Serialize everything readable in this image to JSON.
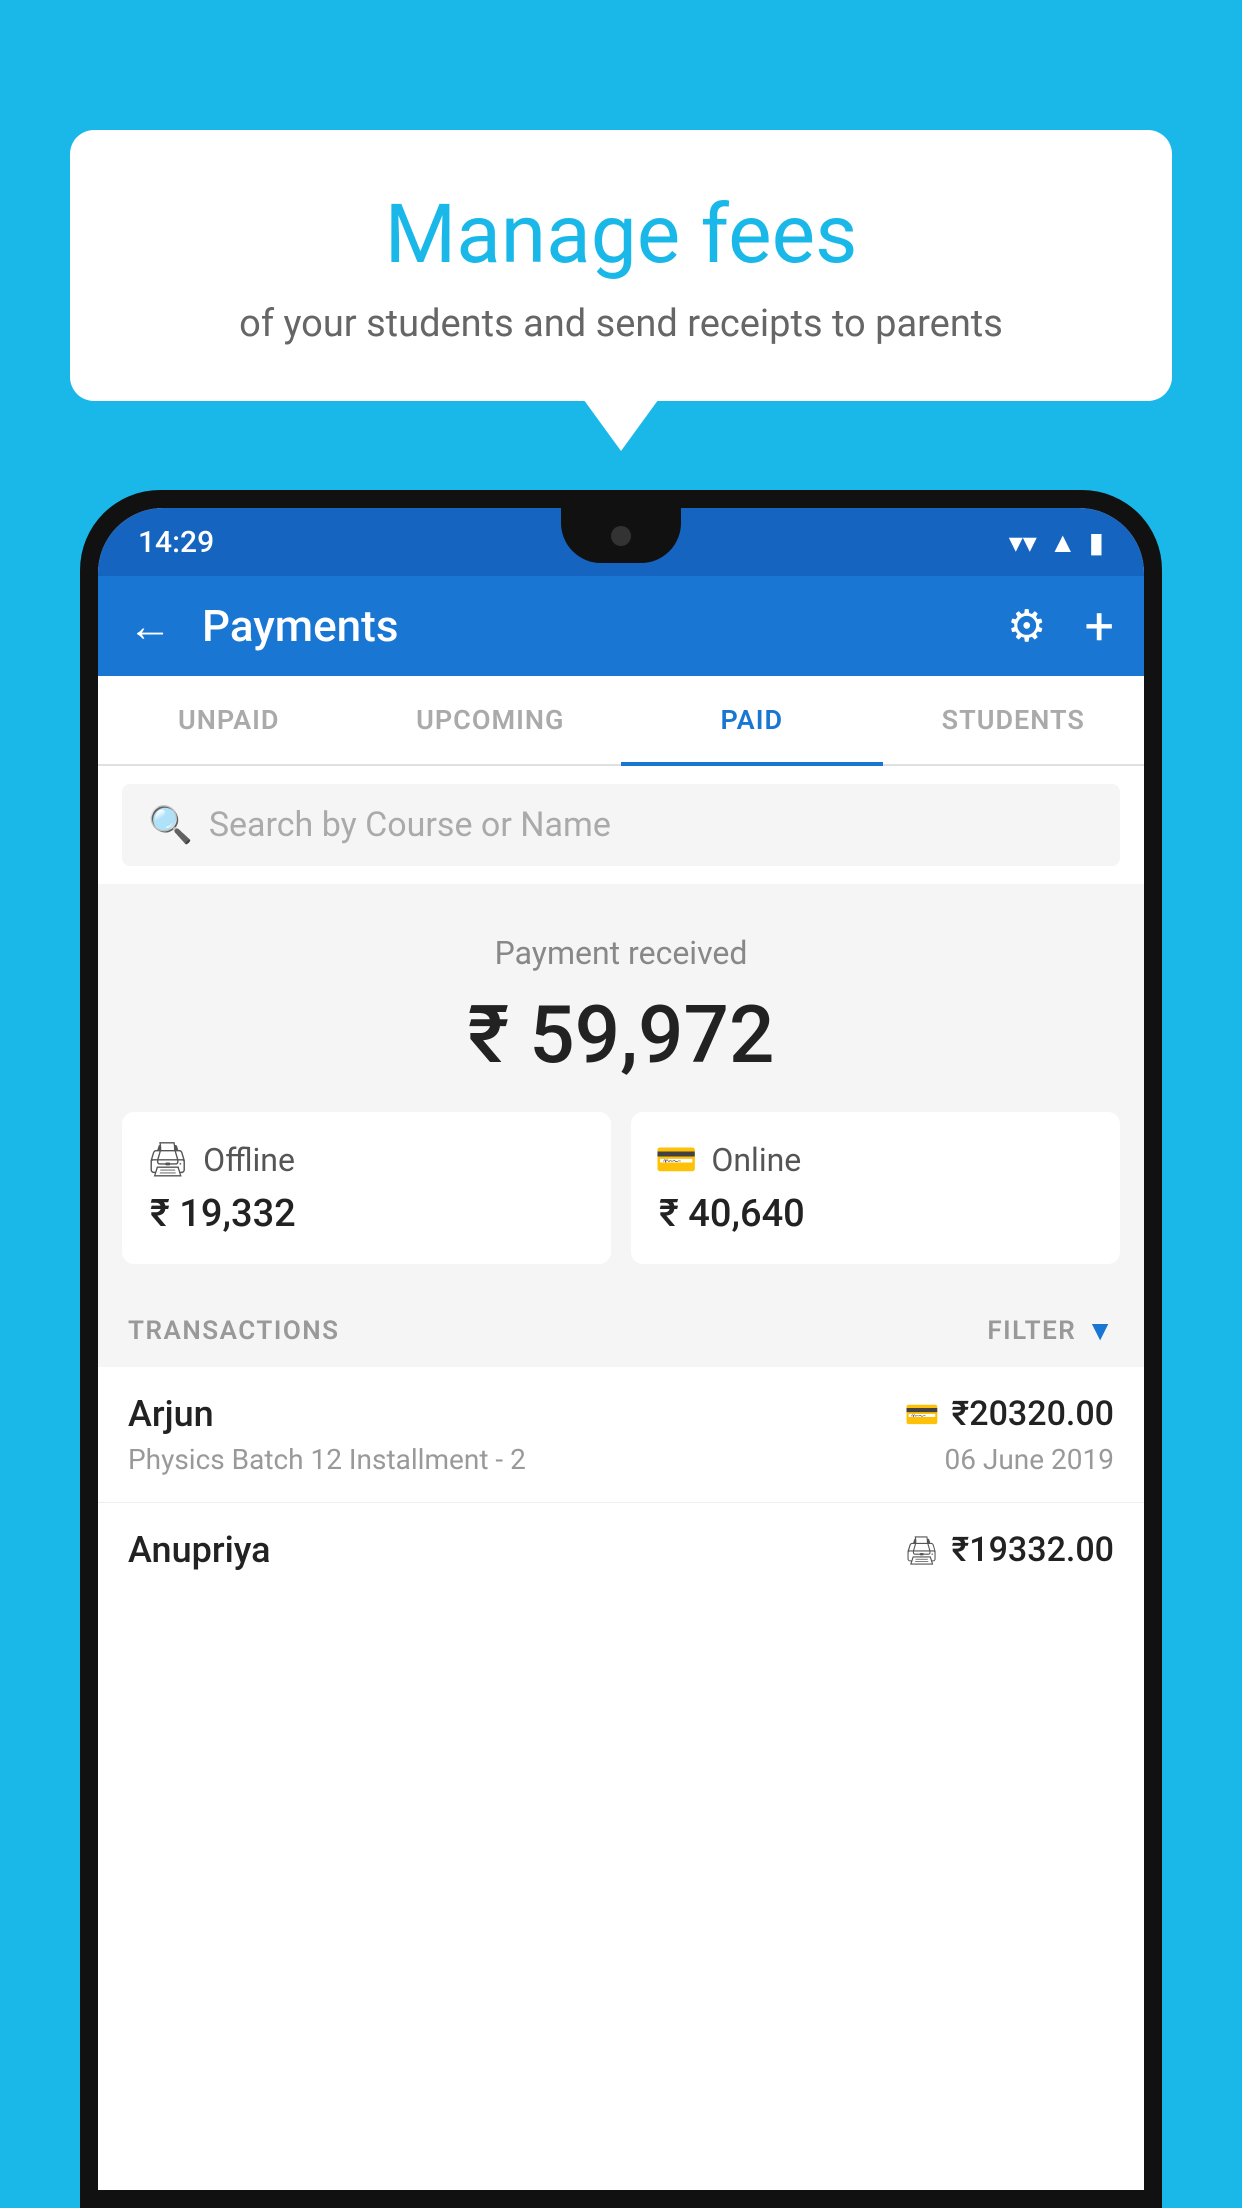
{
  "background_color": "#1ab8e8",
  "bubble": {
    "title": "Manage fees",
    "subtitle": "of your students and send receipts to parents"
  },
  "status_bar": {
    "time": "14:29",
    "wifi": "▼",
    "signal": "▲",
    "battery": "▮"
  },
  "header": {
    "title": "Payments",
    "back_label": "←",
    "gear_label": "⚙",
    "plus_label": "+"
  },
  "tabs": [
    {
      "label": "UNPAID",
      "active": false
    },
    {
      "label": "UPCOMING",
      "active": false
    },
    {
      "label": "PAID",
      "active": true
    },
    {
      "label": "STUDENTS",
      "active": false
    }
  ],
  "search": {
    "placeholder": "Search by Course or Name"
  },
  "payment_received": {
    "label": "Payment received",
    "amount": "₹ 59,972"
  },
  "payment_cards": [
    {
      "icon": "💳",
      "label": "Offline",
      "amount": "₹ 19,332"
    },
    {
      "icon": "💳",
      "label": "Online",
      "amount": "₹ 40,640"
    }
  ],
  "transactions_section": {
    "label": "TRANSACTIONS",
    "filter_label": "FILTER"
  },
  "transactions": [
    {
      "name": "Arjun",
      "type_icon": "💳",
      "amount": "₹20320.00",
      "detail": "Physics Batch 12 Installment - 2",
      "date": "06 June 2019"
    },
    {
      "name": "Anupriya",
      "type_icon": "💵",
      "amount": "₹19332.00",
      "detail": "",
      "date": ""
    }
  ]
}
